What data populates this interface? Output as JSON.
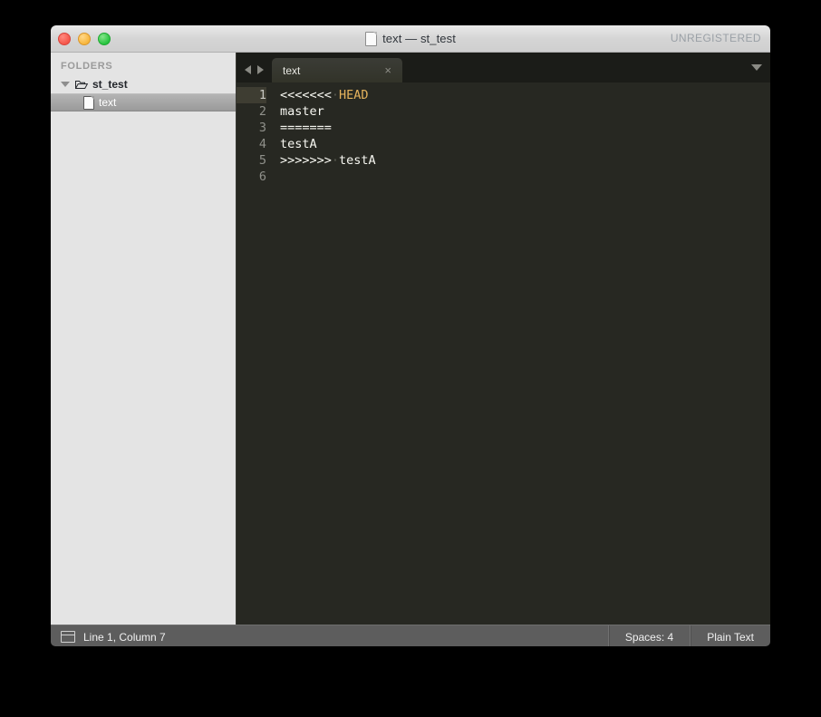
{
  "window": {
    "title": "text — st_test",
    "badge": "UNREGISTERED",
    "doc_icon": "document-icon",
    "traffic_lights": {
      "close": "close-window-button",
      "minimize": "minimize-window-button",
      "maximize": "maximize-window-button"
    }
  },
  "sidebar": {
    "header": "FOLDERS",
    "folder": {
      "name": "st_test",
      "expanded": true,
      "icon": "open-folder-icon",
      "disclosure": "disclosure-triangle-down"
    },
    "files": [
      {
        "name": "text",
        "icon": "file-icon",
        "selected": true
      }
    ]
  },
  "tabbar": {
    "nav_prev": "previous-tab-arrow",
    "nav_next": "next-tab-arrow",
    "tabs": [
      {
        "label": "text",
        "active": true,
        "close": "×"
      }
    ],
    "overflow_menu": "tab-overflow-caret"
  },
  "editor": {
    "line_numbers": [
      "1",
      "2",
      "3",
      "4",
      "5",
      "6"
    ],
    "active_line": 1,
    "lines": [
      {
        "n": 1,
        "segments": [
          {
            "text": "<<<<<<<",
            "style": "marker"
          },
          {
            "text": "·",
            "style": "whitespace"
          },
          {
            "text": "HEAD",
            "style": "head"
          }
        ]
      },
      {
        "n": 2,
        "segments": [
          {
            "text": "master",
            "style": "plain"
          }
        ]
      },
      {
        "n": 3,
        "segments": [
          {
            "text": "=======",
            "style": "marker"
          }
        ]
      },
      {
        "n": 4,
        "segments": [
          {
            "text": "testA",
            "style": "plain"
          }
        ]
      },
      {
        "n": 5,
        "segments": [
          {
            "text": ">>>>>>>",
            "style": "marker"
          },
          {
            "text": "·",
            "style": "whitespace"
          },
          {
            "text": "testA",
            "style": "plain"
          }
        ]
      },
      {
        "n": 6,
        "segments": []
      }
    ]
  },
  "statusbar": {
    "panel_toggle_icon": "sidebar-toggle-icon",
    "cursor_position": "Line 1, Column 7",
    "indentation": "Spaces: 4",
    "syntax": "Plain Text"
  },
  "colors": {
    "editor_bg": "#272822",
    "editor_fg": "#f8f8f2",
    "active_line_bg": "#3e3d32",
    "gutter_fg": "#90918b",
    "head_token": "#e6b35c",
    "sidebar_bg": "#e4e4e4",
    "tabbar_bg": "#1b1c18",
    "statusbar_bg": "#5d5d5d",
    "desktop_bg": "#000000"
  }
}
